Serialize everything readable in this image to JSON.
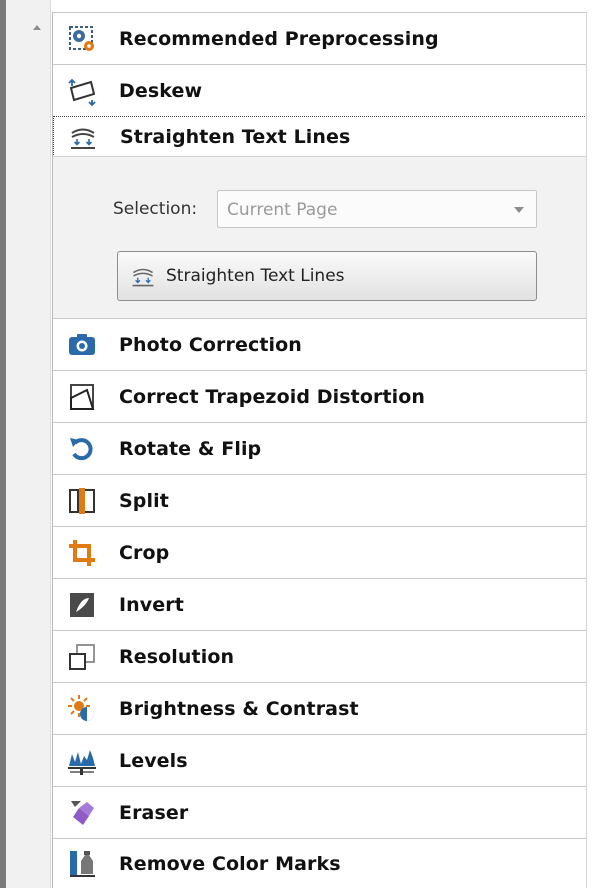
{
  "items_top": [
    {
      "label": "Recommended Preprocessing",
      "icon": "gear-cog-icon"
    },
    {
      "label": "Deskew",
      "icon": "deskew-icon"
    },
    {
      "label": "Straighten Text Lines",
      "icon": "straighten-lines-icon"
    }
  ],
  "selection": {
    "label": "Selection:",
    "value": "Current Page"
  },
  "action_button": {
    "label": "Straighten Text Lines"
  },
  "items_bottom": [
    {
      "label": "Photo Correction",
      "icon": "camera-icon"
    },
    {
      "label": "Correct Trapezoid Distortion",
      "icon": "trapezoid-icon"
    },
    {
      "label": "Rotate & Flip",
      "icon": "rotate-icon"
    },
    {
      "label": "Split",
      "icon": "split-icon"
    },
    {
      "label": "Crop",
      "icon": "crop-icon"
    },
    {
      "label": "Invert",
      "icon": "invert-icon"
    },
    {
      "label": "Resolution",
      "icon": "resolution-icon"
    },
    {
      "label": "Brightness & Contrast",
      "icon": "brightness-icon"
    },
    {
      "label": "Levels",
      "icon": "levels-icon"
    },
    {
      "label": "Eraser",
      "icon": "eraser-icon"
    },
    {
      "label": "Remove Color Marks",
      "icon": "remove-color-marks-icon"
    }
  ],
  "colors": {
    "accent_blue": "#2a6aa8",
    "crop_orange": "#e07a12",
    "eraser_purple": "#8f5cc7"
  }
}
